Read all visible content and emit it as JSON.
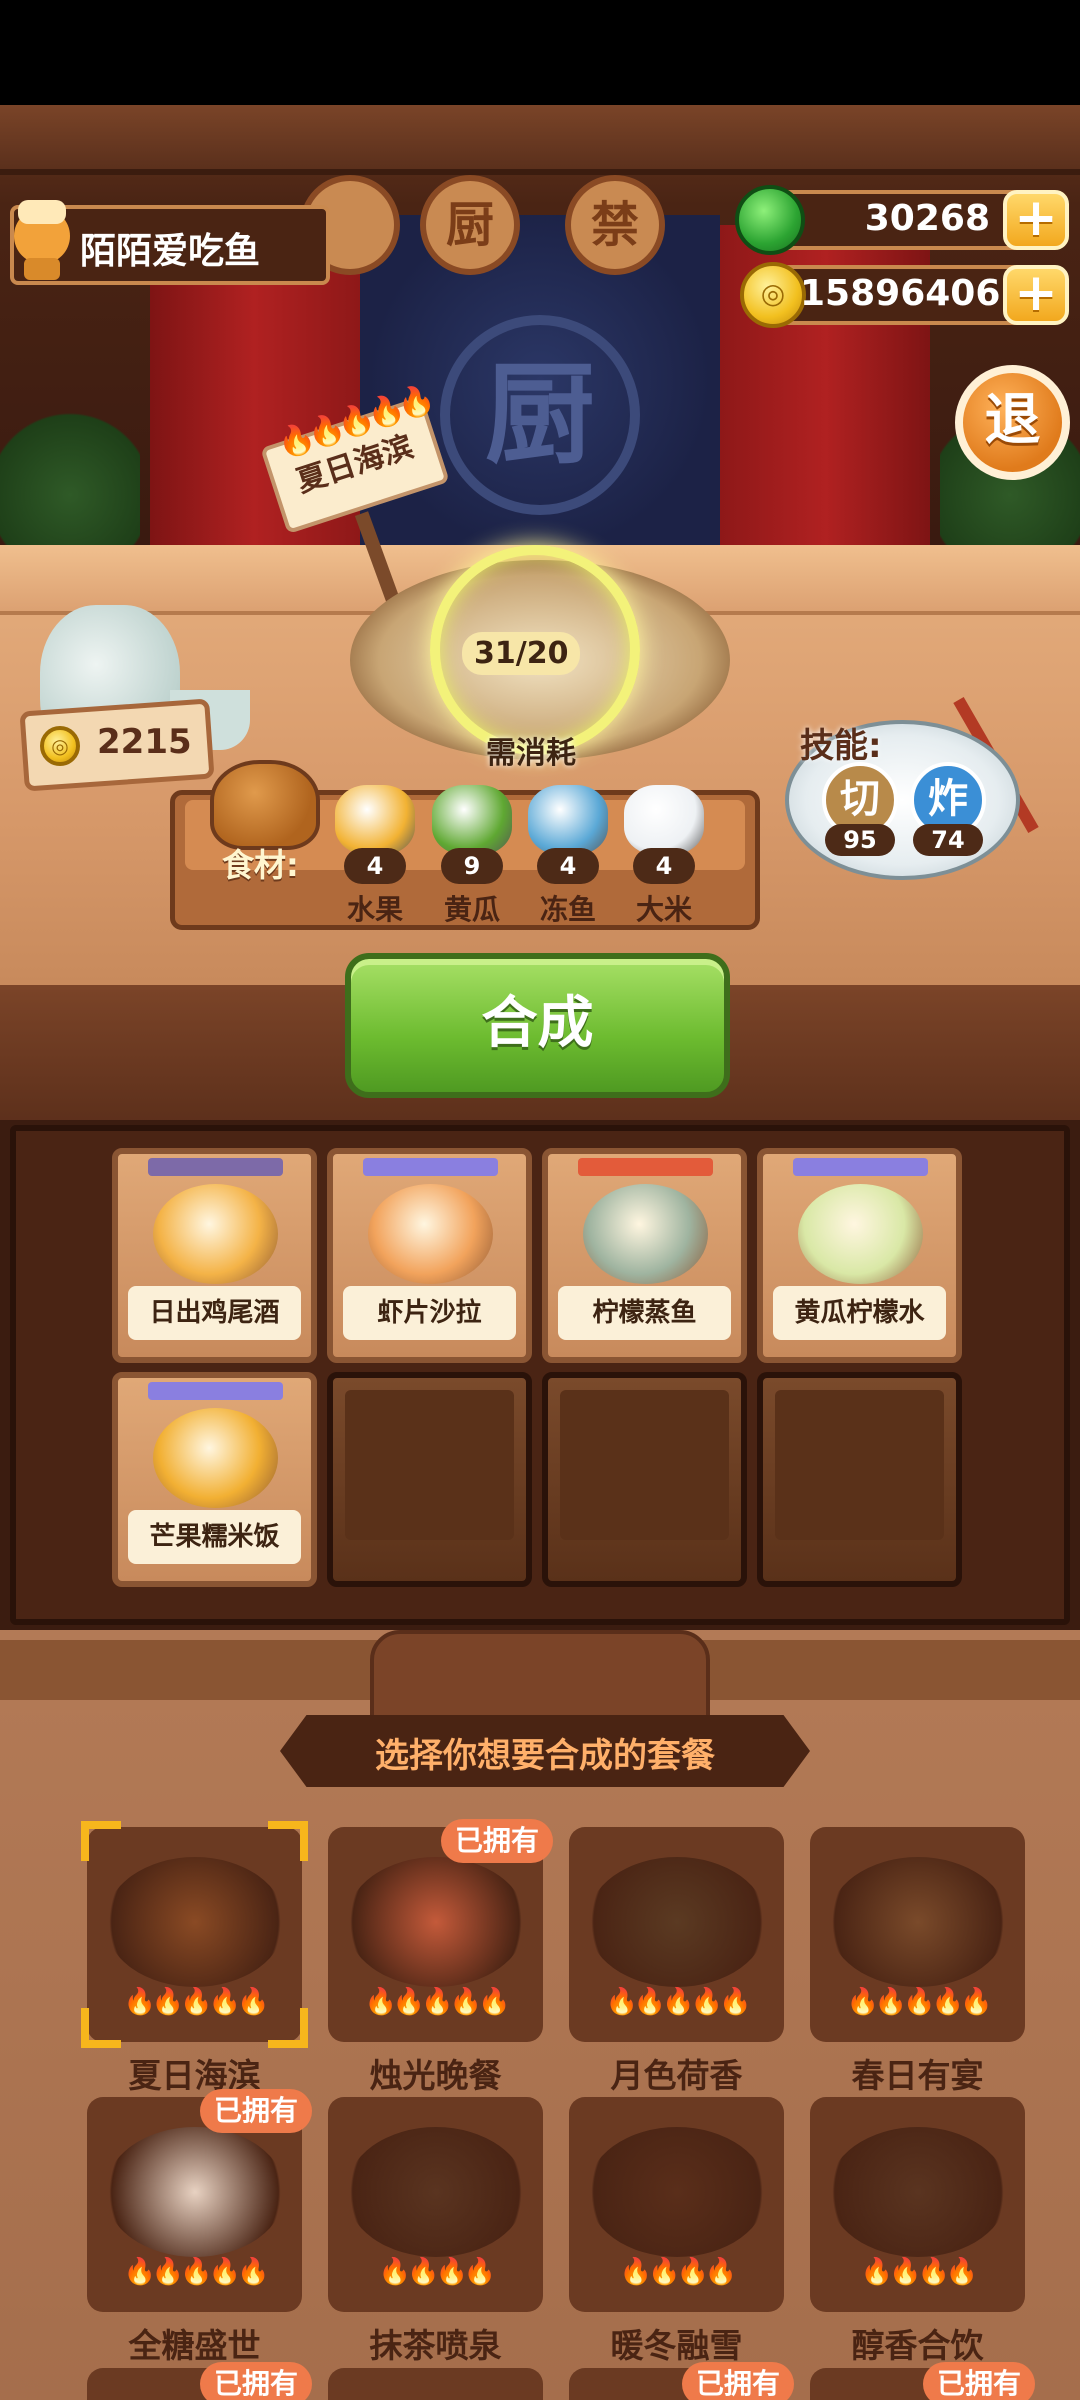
{
  "player": {
    "name": "陌陌爱吃鱼"
  },
  "currency": {
    "gems": "30268",
    "coins": "15896406",
    "plus": "+"
  },
  "exit_label": "退",
  "stage_signs": [
    "",
    "厨",
    "禁",
    ""
  ],
  "dish": {
    "name": "夏日海滨",
    "flames": "🔥🔥🔥🔥🔥",
    "progress": "31/20",
    "need_label": "需消耗"
  },
  "price": {
    "value": "2215"
  },
  "ingredients": {
    "label": "食材:",
    "items": [
      {
        "name": "水果",
        "count": "4",
        "color": "#f2b233"
      },
      {
        "name": "黄瓜",
        "count": "9",
        "color": "#5fa832"
      },
      {
        "name": "冻鱼",
        "count": "4",
        "color": "#5aa8d6"
      },
      {
        "name": "大米",
        "count": "4",
        "color": "#eef1f4"
      }
    ]
  },
  "skills": {
    "label": "技能:",
    "items": [
      {
        "name": "切",
        "value": "95",
        "color": "#b88a4a"
      },
      {
        "name": "炸",
        "value": "74",
        "color": "#3b8fd6"
      }
    ]
  },
  "craft_button": "合成",
  "shelf": {
    "slots": [
      {
        "name": "日出鸡尾酒",
        "bar": "#7d6aa8",
        "food": "#f4b347"
      },
      {
        "name": "虾片沙拉",
        "bar": "#8a7fe0",
        "food": "#f2a35c"
      },
      {
        "name": "柠檬蒸鱼",
        "bar": "#e35b3a",
        "food": "#9fb4a0"
      },
      {
        "name": "黄瓜柠檬水",
        "bar": "#8a7fe0",
        "food": "#d9e8a6"
      },
      {
        "name": "芒果糯米饭",
        "bar": "#8a7fe0",
        "food": "#f2b033"
      },
      {
        "name": "",
        "bar": "",
        "food": ""
      },
      {
        "name": "",
        "bar": "",
        "food": ""
      },
      {
        "name": "",
        "bar": "",
        "food": ""
      }
    ]
  },
  "select_title": "选择你想要合成的套餐",
  "meals": [
    {
      "name": "夏日海滨",
      "flames": "🔥🔥🔥🔥🔥",
      "owned": "",
      "selected": true,
      "color": "#8a4a24"
    },
    {
      "name": "烛光晚餐",
      "flames": "🔥🔥🔥🔥🔥",
      "owned": "已拥有",
      "selected": false,
      "color": "#c45a3a"
    },
    {
      "name": "月色荷香",
      "flames": "🔥🔥🔥🔥🔥",
      "owned": "",
      "selected": false,
      "color": "#5b3a22"
    },
    {
      "name": "春日有宴",
      "flames": "🔥🔥🔥🔥🔥",
      "owned": "",
      "selected": false,
      "color": "#7a4a2a"
    },
    {
      "name": "全糖盛世",
      "flames": "🔥🔥🔥🔥🔥",
      "owned": "已拥有",
      "selected": false,
      "color": "#e8d2c2"
    },
    {
      "name": "抹茶喷泉",
      "flames": "🔥🔥🔥🔥",
      "owned": "",
      "selected": false,
      "color": "#5a3420"
    },
    {
      "name": "暖冬融雪",
      "flames": "🔥🔥🔥🔥",
      "owned": "",
      "selected": false,
      "color": "#5a2e1a"
    },
    {
      "name": "醇香合饮",
      "flames": "🔥🔥🔥🔥",
      "owned": "",
      "selected": false,
      "color": "#5a3420"
    }
  ],
  "next_row_badges": [
    "已拥有",
    "",
    "已拥有",
    "已拥有"
  ]
}
